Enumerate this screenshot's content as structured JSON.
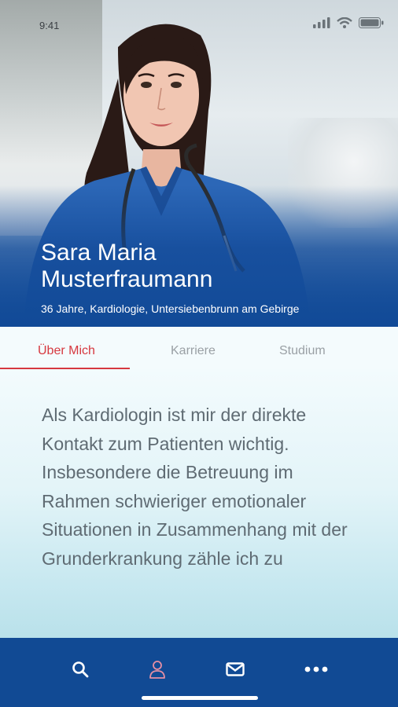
{
  "status_bar": {
    "time": "9:41"
  },
  "profile": {
    "name_line1": "Sara Maria",
    "name_line2": "Musterfraumann",
    "subtitle": "36 Jahre, Kardiologie, Untersiebenbrunn am Gebirge"
  },
  "tabs": [
    {
      "label": "Über Mich",
      "active": true
    },
    {
      "label": "Karriere",
      "active": false
    },
    {
      "label": "Studium",
      "active": false
    }
  ],
  "about": {
    "text": "Als Kardiologin ist mir der direkte Kontakt zum Patienten wichtig. Insbesondere die Betreuung im Rahmen schwieriger emotionaler Situationen in Zusammenhang mit der Grunderkrankung zähle ich zu"
  },
  "bottom_nav": [
    {
      "icon": "search-icon",
      "active": false
    },
    {
      "icon": "profile-icon",
      "active": true
    },
    {
      "icon": "mail-icon",
      "active": false
    },
    {
      "icon": "more-icon",
      "active": false
    }
  ],
  "colors": {
    "accent": "#d6383f",
    "nav_bg": "#114a94",
    "active_icon": "#e58fa4"
  }
}
